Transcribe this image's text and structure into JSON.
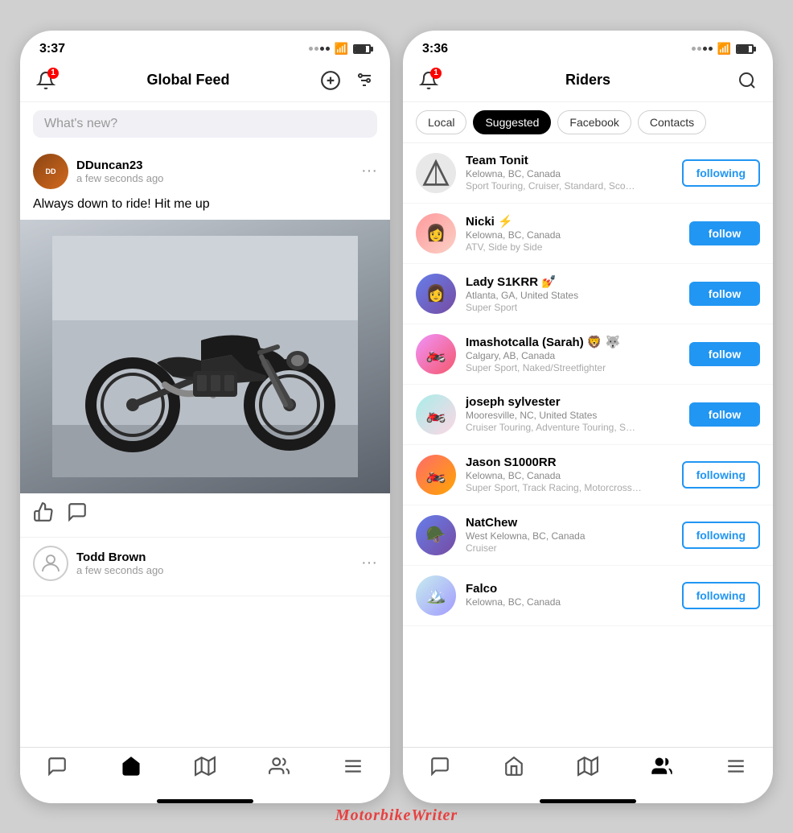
{
  "leftPhone": {
    "statusBar": {
      "time": "3:37",
      "hasArrow": true
    },
    "header": {
      "title": "Global Feed",
      "bell_badge": "1"
    },
    "searchPlaceholder": "What's new?",
    "posts": [
      {
        "id": "post1",
        "username": "DDuncan23",
        "time": "a few seconds ago",
        "text": "Always down to ride! Hit me up",
        "hasImage": true,
        "dots": "···"
      },
      {
        "id": "post2",
        "username": "Todd Brown",
        "time": "a few seconds ago",
        "text": "",
        "hasImage": false,
        "dots": "···"
      }
    ],
    "nav": [
      "chat",
      "home",
      "map",
      "people",
      "menu"
    ]
  },
  "rightPhone": {
    "statusBar": {
      "time": "3:36",
      "hasArrow": true
    },
    "header": {
      "title": "Riders",
      "bell_badge": "1"
    },
    "tabs": [
      {
        "label": "Local",
        "active": false
      },
      {
        "label": "Suggested",
        "active": true
      },
      {
        "label": "Facebook",
        "active": false
      },
      {
        "label": "Contacts",
        "active": false
      }
    ],
    "riders": [
      {
        "name": "Team Tonit",
        "location": "Kelowna, BC, Canada",
        "tags": "Sport Touring, Cruiser, Standard, Sco…",
        "status": "following",
        "avatarType": "logo"
      },
      {
        "name": "Nicki ⚡",
        "location": "Kelowna, BC, Canada",
        "tags": "ATV, Side by Side",
        "status": "follow",
        "avatarType": "person"
      },
      {
        "name": "Lady S1KRR 💅",
        "location": "Atlanta, GA, United States",
        "tags": "Super Sport",
        "status": "follow",
        "avatarType": "person"
      },
      {
        "name": "Imashotcalla (Sarah) 🦁 🐺",
        "location": "Calgary, AB, Canada",
        "tags": "Super Sport, Naked/Streetfighter",
        "status": "follow",
        "avatarType": "person"
      },
      {
        "name": "joseph sylvester",
        "location": "Mooresville, NC, United States",
        "tags": "Cruiser Touring, Adventure Touring, S…",
        "status": "follow",
        "avatarType": "moto"
      },
      {
        "name": "Jason S1000RR",
        "location": "Kelowna, BC, Canada",
        "tags": "Super Sport, Track Racing, Motorcross…",
        "status": "following",
        "avatarType": "moto"
      },
      {
        "name": "NatChew",
        "location": "West Kelowna, BC, Canada",
        "tags": "Cruiser",
        "status": "following",
        "avatarType": "helmet"
      },
      {
        "name": "Falco",
        "location": "Kelowna, BC, Canada",
        "tags": "",
        "status": "following",
        "avatarType": "landscape"
      }
    ],
    "nav": [
      "chat",
      "home",
      "map",
      "people",
      "menu"
    ]
  },
  "watermark": "MotorbikeWriter"
}
